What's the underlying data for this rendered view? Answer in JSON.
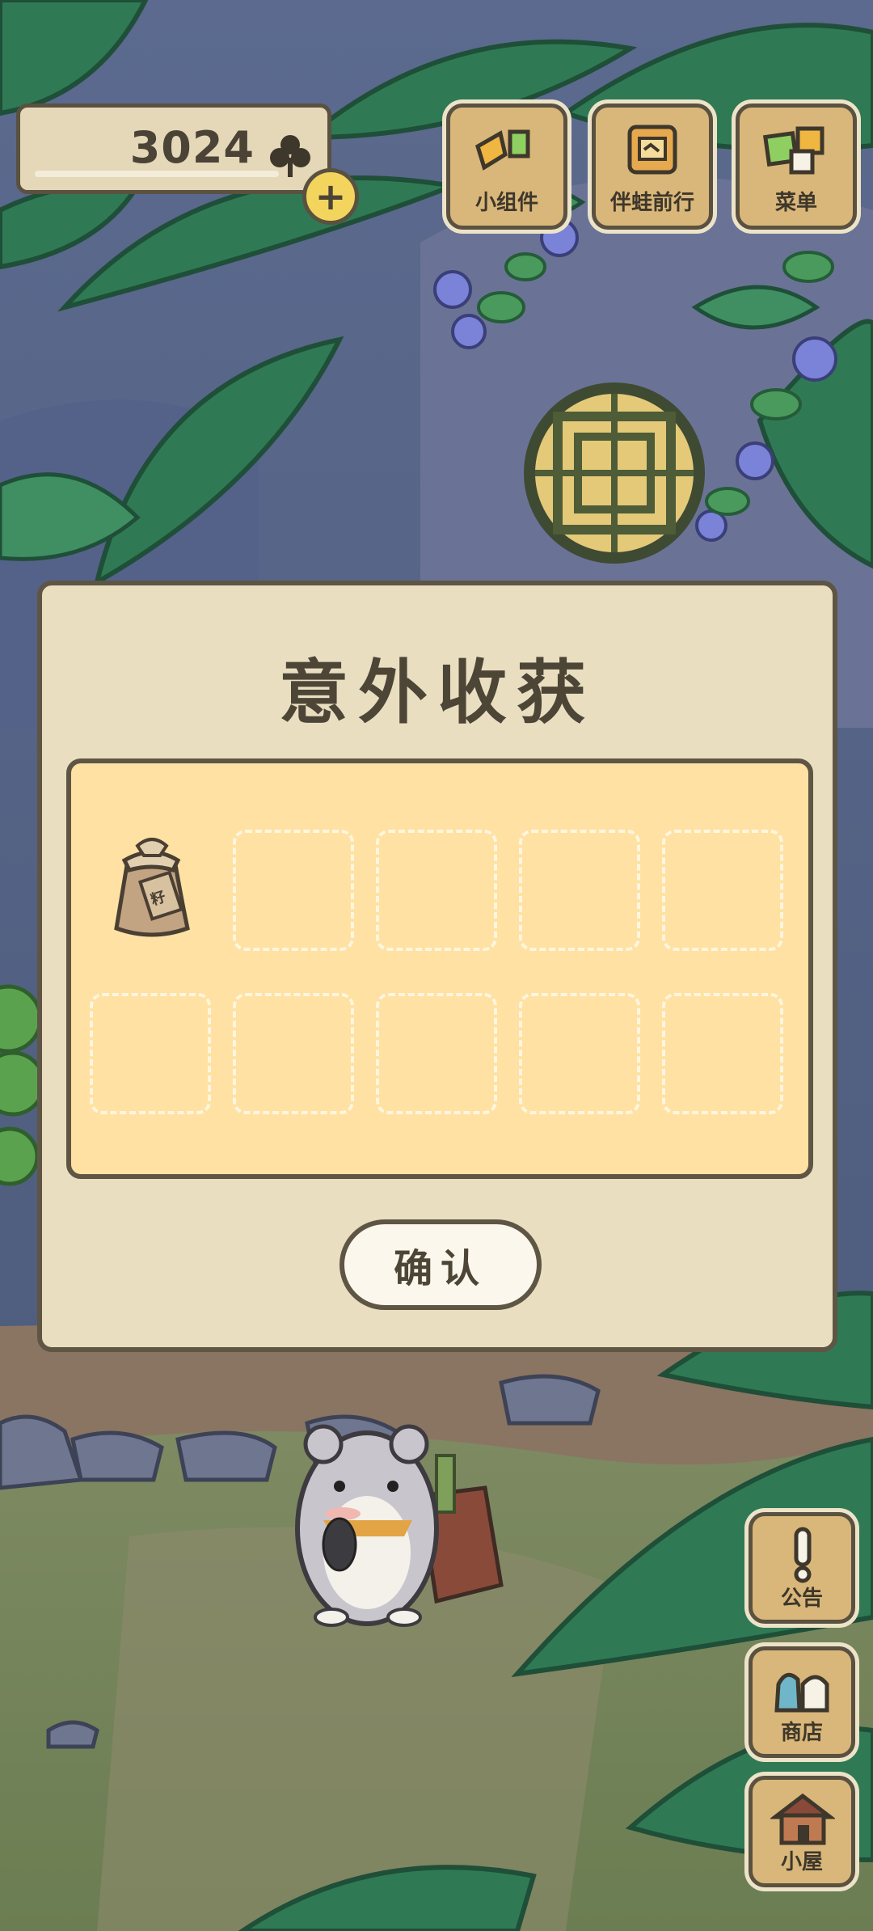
{
  "hud": {
    "currency_value": "3024",
    "currency_icon": "clover-icon",
    "add_currency_label": "+"
  },
  "top_buttons": [
    {
      "label": "小组件",
      "icon": "widget-icon"
    },
    {
      "label": "伴蛙前行",
      "icon": "frog-journey-icon"
    },
    {
      "label": "菜单",
      "icon": "menu-icon"
    }
  ],
  "side_buttons": [
    {
      "label": "公告",
      "icon": "notice-icon"
    },
    {
      "label": "商店",
      "icon": "shop-icon"
    },
    {
      "label": "小屋",
      "icon": "house-icon"
    }
  ],
  "dialog": {
    "title": "意外收获",
    "confirm_label": "确认",
    "slots": [
      {
        "item": "seed-bag-icon"
      },
      {
        "item": null
      },
      {
        "item": null
      },
      {
        "item": null
      },
      {
        "item": null
      },
      {
        "item": null
      },
      {
        "item": null
      },
      {
        "item": null
      },
      {
        "item": null
      },
      {
        "item": null
      }
    ]
  },
  "colors": {
    "panel_bg": "#e9dfc0",
    "grid_bg": "#ffe1a3",
    "outline": "#5e5544",
    "button_wood": "#d9b77a",
    "coin_yellow": "#f3d55d"
  }
}
